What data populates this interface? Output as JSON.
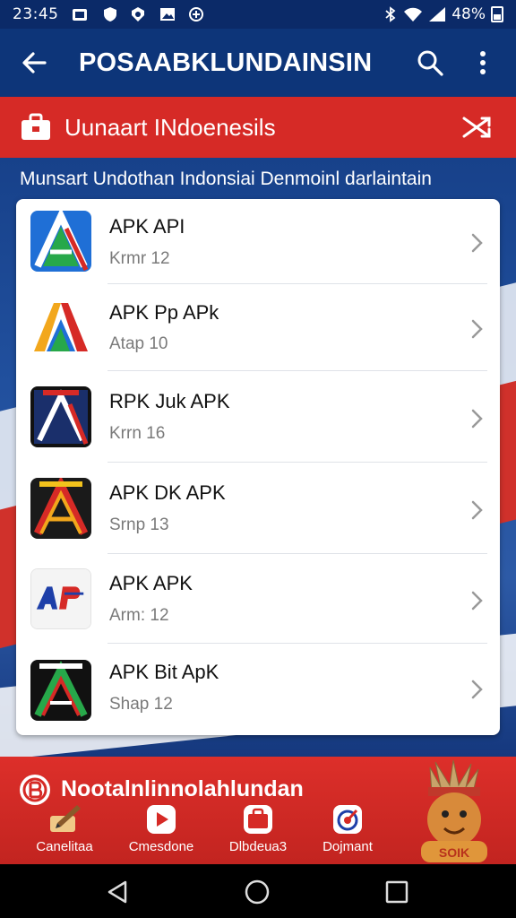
{
  "status_bar": {
    "time": "23:45",
    "battery": "48%",
    "icons": [
      "gallery-icon",
      "shield-icon",
      "shield-icon",
      "image-icon",
      "game-icon",
      "bluetooth-icon",
      "wifi-icon",
      "signal-icon",
      "battery-icon"
    ]
  },
  "app_bar": {
    "title": "POSAABKLUNDAINSIN",
    "icons": [
      "back-arrow-icon",
      "search-icon",
      "more-vert-icon"
    ]
  },
  "banner": {
    "text": "Uunaart INdoenesils",
    "icons": [
      "briefcase-icon",
      "shuffle-icon"
    ]
  },
  "subtitle": "Munsart Undothan Indonsiai Denmoinl darlaintain",
  "apps": [
    {
      "name": "APK API",
      "meta": "Krmr 12",
      "icon": "apk-app-icon-1"
    },
    {
      "name": "APK Pp APk",
      "meta": "Atap 10",
      "icon": "apk-app-icon-2"
    },
    {
      "name": "RPK Juk APK",
      "meta": "Krrn 16",
      "icon": "apk-app-icon-3"
    },
    {
      "name": "APK DK APK",
      "meta": "Srnp 13",
      "icon": "apk-app-icon-4"
    },
    {
      "name": "APK APK",
      "meta": "Arm: 12",
      "icon": "apk-app-icon-5"
    },
    {
      "name": "APK Bit ApK",
      "meta": "Shap 12",
      "icon": "apk-app-icon-6"
    }
  ],
  "bottom": {
    "promo_text": "Nootalnlinnolahlundan",
    "tabs": [
      {
        "label": "Canelitaa",
        "icon": "pencil-icon"
      },
      {
        "label": "Cmesdone",
        "icon": "play-icon"
      },
      {
        "label": "Dlbdeua3",
        "icon": "briefcase-icon"
      },
      {
        "label": "Dojmant",
        "icon": "target-icon"
      }
    ],
    "mascot_text": "SOIK"
  },
  "colors": {
    "app_bar": "#0d3579",
    "banner": "#d62a26",
    "bottom": "#d02824",
    "navbar": "#000000"
  }
}
